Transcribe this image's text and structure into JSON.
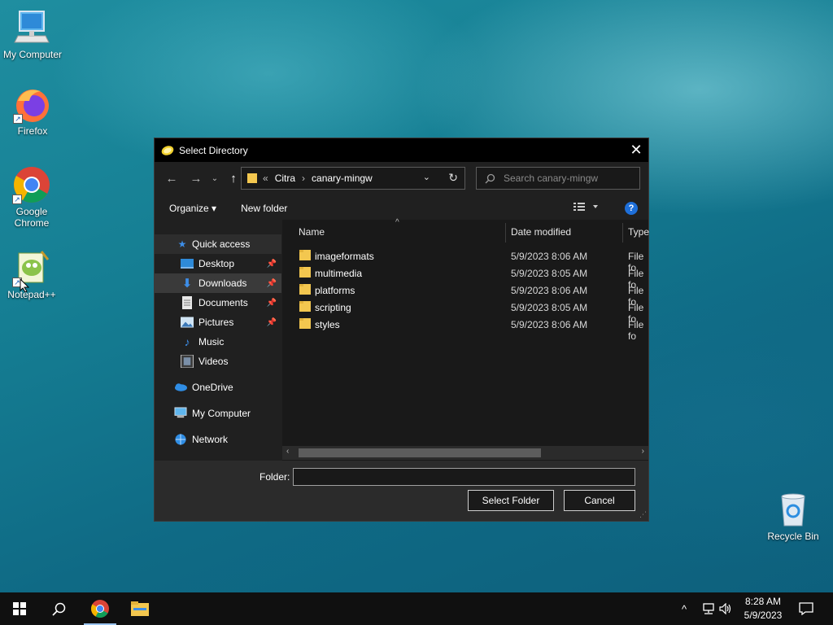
{
  "desktop": {
    "icons": [
      {
        "label": "My Computer"
      },
      {
        "label": "Firefox"
      },
      {
        "label": "Google Chrome"
      },
      {
        "label": "Notepad++"
      },
      {
        "label": "Recycle Bin"
      }
    ]
  },
  "dialog": {
    "title": "Select Directory",
    "address": {
      "overflow": "«",
      "crumbs": [
        "Citra",
        "canary-mingw"
      ],
      "separator": "›"
    },
    "search_placeholder": "Search canary-mingw",
    "toolbar": {
      "organize": "Organize ▾",
      "new_folder": "New folder",
      "help": "?"
    },
    "nav": {
      "quick_access": "Quick access",
      "items": [
        {
          "label": "Desktop",
          "pinned": true
        },
        {
          "label": "Downloads",
          "pinned": true
        },
        {
          "label": "Documents",
          "pinned": true
        },
        {
          "label": "Pictures",
          "pinned": true
        },
        {
          "label": "Music",
          "pinned": false
        },
        {
          "label": "Videos",
          "pinned": false
        }
      ],
      "onedrive": "OneDrive",
      "my_computer": "My Computer",
      "network": "Network"
    },
    "columns": {
      "name": "Name",
      "date": "Date modified",
      "type": "Type"
    },
    "files": [
      {
        "name": "imageformats",
        "date": "5/9/2023 8:06 AM",
        "type": "File fo"
      },
      {
        "name": "multimedia",
        "date": "5/9/2023 8:05 AM",
        "type": "File fo"
      },
      {
        "name": "platforms",
        "date": "5/9/2023 8:06 AM",
        "type": "File fo"
      },
      {
        "name": "scripting",
        "date": "5/9/2023 8:05 AM",
        "type": "File fo"
      },
      {
        "name": "styles",
        "date": "5/9/2023 8:06 AM",
        "type": "File fo"
      }
    ],
    "folder_label": "Folder:",
    "folder_value": "",
    "select_folder": "Select Folder",
    "cancel": "Cancel"
  },
  "taskbar": {
    "clock_time": "8:28 AM",
    "clock_date": "5/9/2023"
  },
  "colors": {
    "accent": "#1e6fd9",
    "folder": "#f3c74f",
    "dialog_bg": "#202020"
  }
}
